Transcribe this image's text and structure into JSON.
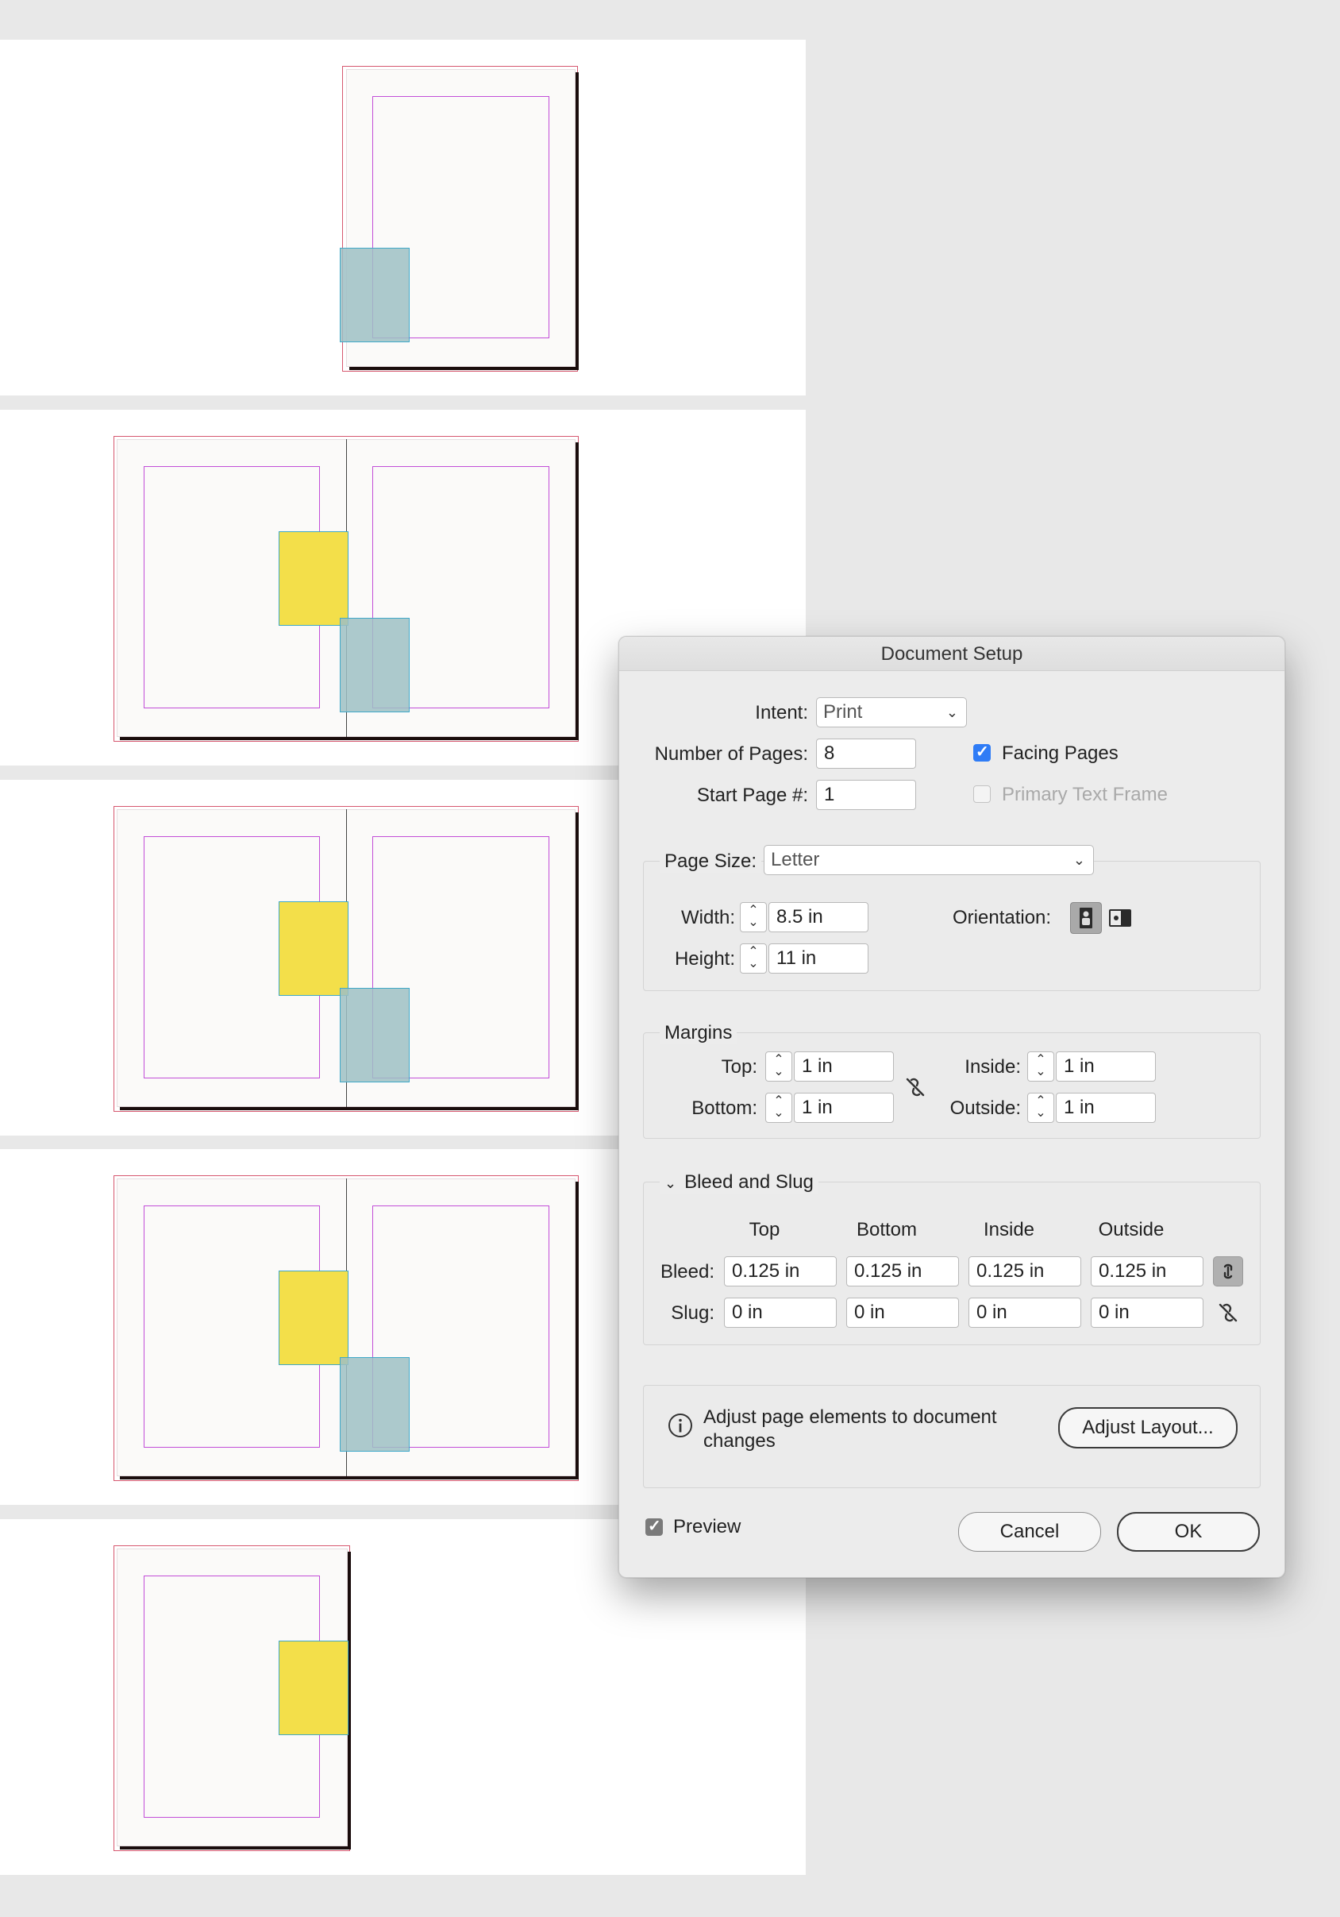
{
  "dialog": {
    "title": "Document Setup",
    "intent": {
      "label": "Intent:",
      "value": "Print"
    },
    "number_of_pages": {
      "label": "Number of Pages:",
      "value": "8"
    },
    "start_page": {
      "label": "Start Page #:",
      "value": "1"
    },
    "facing_pages": {
      "label": "Facing Pages",
      "checked": true
    },
    "primary_text_frame": {
      "label": "Primary Text Frame",
      "checked": false
    },
    "page_size": {
      "label": "Page Size:",
      "value": "Letter",
      "width_label": "Width:",
      "width": "8.5 in",
      "height_label": "Height:",
      "height": "11 in",
      "orientation_label": "Orientation:"
    },
    "margins": {
      "title": "Margins",
      "top_label": "Top:",
      "top": "1 in",
      "bottom_label": "Bottom:",
      "bottom": "1 in",
      "inside_label": "Inside:",
      "inside": "1 in",
      "outside_label": "Outside:",
      "outside": "1 in"
    },
    "bleed_slug": {
      "title": "Bleed and Slug",
      "columns": [
        "Top",
        "Bottom",
        "Inside",
        "Outside"
      ],
      "bleed_label": "Bleed:",
      "bleed": [
        "0.125 in",
        "0.125 in",
        "0.125 in",
        "0.125 in"
      ],
      "slug_label": "Slug:",
      "slug": [
        "0 in",
        "0 in",
        "0 in",
        "0 in"
      ]
    },
    "adjust": {
      "message": "Adjust page elements to document changes",
      "button": "Adjust Layout..."
    },
    "preview": {
      "label": "Preview",
      "checked": true
    },
    "cancel": "Cancel",
    "ok": "OK"
  },
  "colors": {
    "margin_guide": "#c24ed8",
    "bleed_guide": "#d6576f",
    "yellow_frame": "#f3df4a",
    "teal_frame": "#9dc0c4",
    "checkbox_accent": "#2f7cf6"
  }
}
